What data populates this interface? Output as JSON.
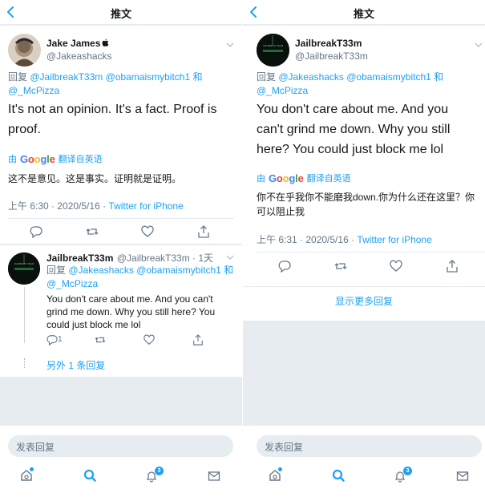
{
  "header": {
    "title": "推文"
  },
  "left": {
    "main_tweet": {
      "name": "Jake James",
      "handle": "@Jakeashacks",
      "reply_prefix": "回复",
      "reply_to": "@JailbreakT33m @obamaismybitch1 和 @_McPizza",
      "text": "It's not an opinion. It's a fact. Proof is proof.",
      "translate": "翻译自英语",
      "translation": "这不是意见。这是事实。证明就是证明。",
      "time": "上午 6:30 · 2020/5/16 · ",
      "source": "Twitter for iPhone"
    },
    "reply": {
      "name": "JailbreakT33m",
      "handle": "@JailbreakT33m · 1天",
      "reply_prefix": "回复",
      "reply_to": "@Jakeashacks @obamaismybitch1 和 @_McPizza",
      "text": "You don't care about me. And you can't grind me down. Why you still here? You could just block me lol",
      "reply_count": "1",
      "more_replies": "另外 1 条回复"
    }
  },
  "right": {
    "main_tweet": {
      "name": "JailbreakT33m",
      "handle": "@JailbreakT33m",
      "reply_prefix": "回复",
      "reply_to": "@Jakeashacks @obamaismybitch1 和 @_McPizza",
      "text": "You don't care about me. And you can't grind me down. Why you still here? You could just block me lol",
      "translate": "翻译自英语",
      "translation": "你不在乎我你不能磨我down.你为什么还在这里？你可以阻止我",
      "time": "上午 6:31 · 2020/5/16 · ",
      "source": "Twitter for iPhone"
    },
    "show_more": "显示更多回复"
  },
  "google": {
    "g1": "G",
    "g2": "o",
    "g3": "o",
    "g4": "g",
    "g5": "l",
    "g6": "e"
  },
  "composer": {
    "placeholder": "发表回复"
  },
  "tabbar": {
    "notifications_badge": "3"
  },
  "avatar_text": "JAILBREAK TEAM",
  "colors": {
    "accent": "#1da1f2",
    "muted": "#657786",
    "separator": "#e6ecf0"
  },
  "icons": [
    "back-icon",
    "chevron-down-icon",
    "apple-icon",
    "reply-icon",
    "retweet-icon",
    "like-icon",
    "share-icon",
    "home-icon",
    "search-icon",
    "notifications-icon",
    "messages-icon"
  ]
}
